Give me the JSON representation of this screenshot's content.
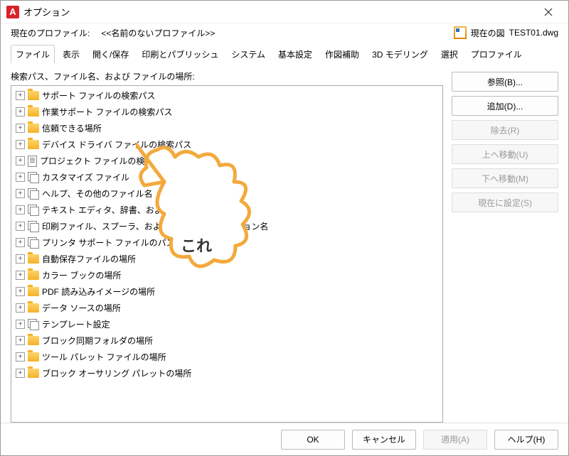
{
  "window": {
    "title": "オプション",
    "app_icon_letter": "A"
  },
  "profile": {
    "label": "現在のプロファイル:",
    "name": "<<名前のないプロファイル>>",
    "drawing_label": "現在の図",
    "drawing_file": "TEST01.dwg"
  },
  "tabs": [
    {
      "label": "ファイル",
      "active": true
    },
    {
      "label": "表示"
    },
    {
      "label": "開く/保存"
    },
    {
      "label": "印刷とパブリッシュ"
    },
    {
      "label": "システム"
    },
    {
      "label": "基本設定"
    },
    {
      "label": "作図補助"
    },
    {
      "label": "3D モデリング"
    },
    {
      "label": "選択"
    },
    {
      "label": "プロファイル"
    }
  ],
  "section_label": "検索パス、ファイル名、および ファイルの場所:",
  "tree": [
    {
      "icon": "folder",
      "label": "サポート ファイルの検索パス"
    },
    {
      "icon": "folder",
      "label": "作業サポート ファイルの検索パス"
    },
    {
      "icon": "folder",
      "label": "信頼できる場所"
    },
    {
      "icon": "folder",
      "label": "デバイス ドライバ ファイルの検索パス"
    },
    {
      "icon": "doc",
      "label": "プロジェクト ファイルの検索パス"
    },
    {
      "icon": "multi",
      "label": "カスタマイズ ファイル"
    },
    {
      "icon": "multi",
      "label": "ヘルプ、その他のファイル名"
    },
    {
      "icon": "multi",
      "label": "テキスト エディタ、辞書、およびフォント ファイル名"
    },
    {
      "icon": "multi",
      "label": "印刷ファイル、スプーラ、および プロローグ セクション名"
    },
    {
      "icon": "multi",
      "label": "プリンタ サポート ファイルのパス"
    },
    {
      "icon": "folder",
      "label": "自動保存ファイルの場所"
    },
    {
      "icon": "folder",
      "label": "カラー ブックの場所"
    },
    {
      "icon": "folder",
      "label": "PDF 読み込みイメージの場所"
    },
    {
      "icon": "folder",
      "label": "データ ソースの場所"
    },
    {
      "icon": "multi",
      "label": "テンプレート設定"
    },
    {
      "icon": "folder",
      "label": "ブロック同期フォルダの場所"
    },
    {
      "icon": "folder",
      "label": "ツール パレット ファイルの場所"
    },
    {
      "icon": "folder",
      "label": "ブロック オーサリング パレットの場所"
    }
  ],
  "side_buttons": [
    {
      "label": "参照(B)...",
      "enabled": true
    },
    {
      "label": "追加(D)...",
      "enabled": true
    },
    {
      "label": "除去(R)",
      "enabled": false
    },
    {
      "label": "上へ移動(U)",
      "enabled": false
    },
    {
      "label": "下へ移動(M)",
      "enabled": false
    },
    {
      "label": "現在に設定(S)",
      "enabled": false
    }
  ],
  "footer_buttons": [
    {
      "label": "OK",
      "enabled": true
    },
    {
      "label": "キャンセル",
      "enabled": true
    },
    {
      "label": "適用(A)",
      "enabled": false
    },
    {
      "label": "ヘルプ(H)",
      "enabled": true
    }
  ],
  "annotation": {
    "text": "これ"
  }
}
